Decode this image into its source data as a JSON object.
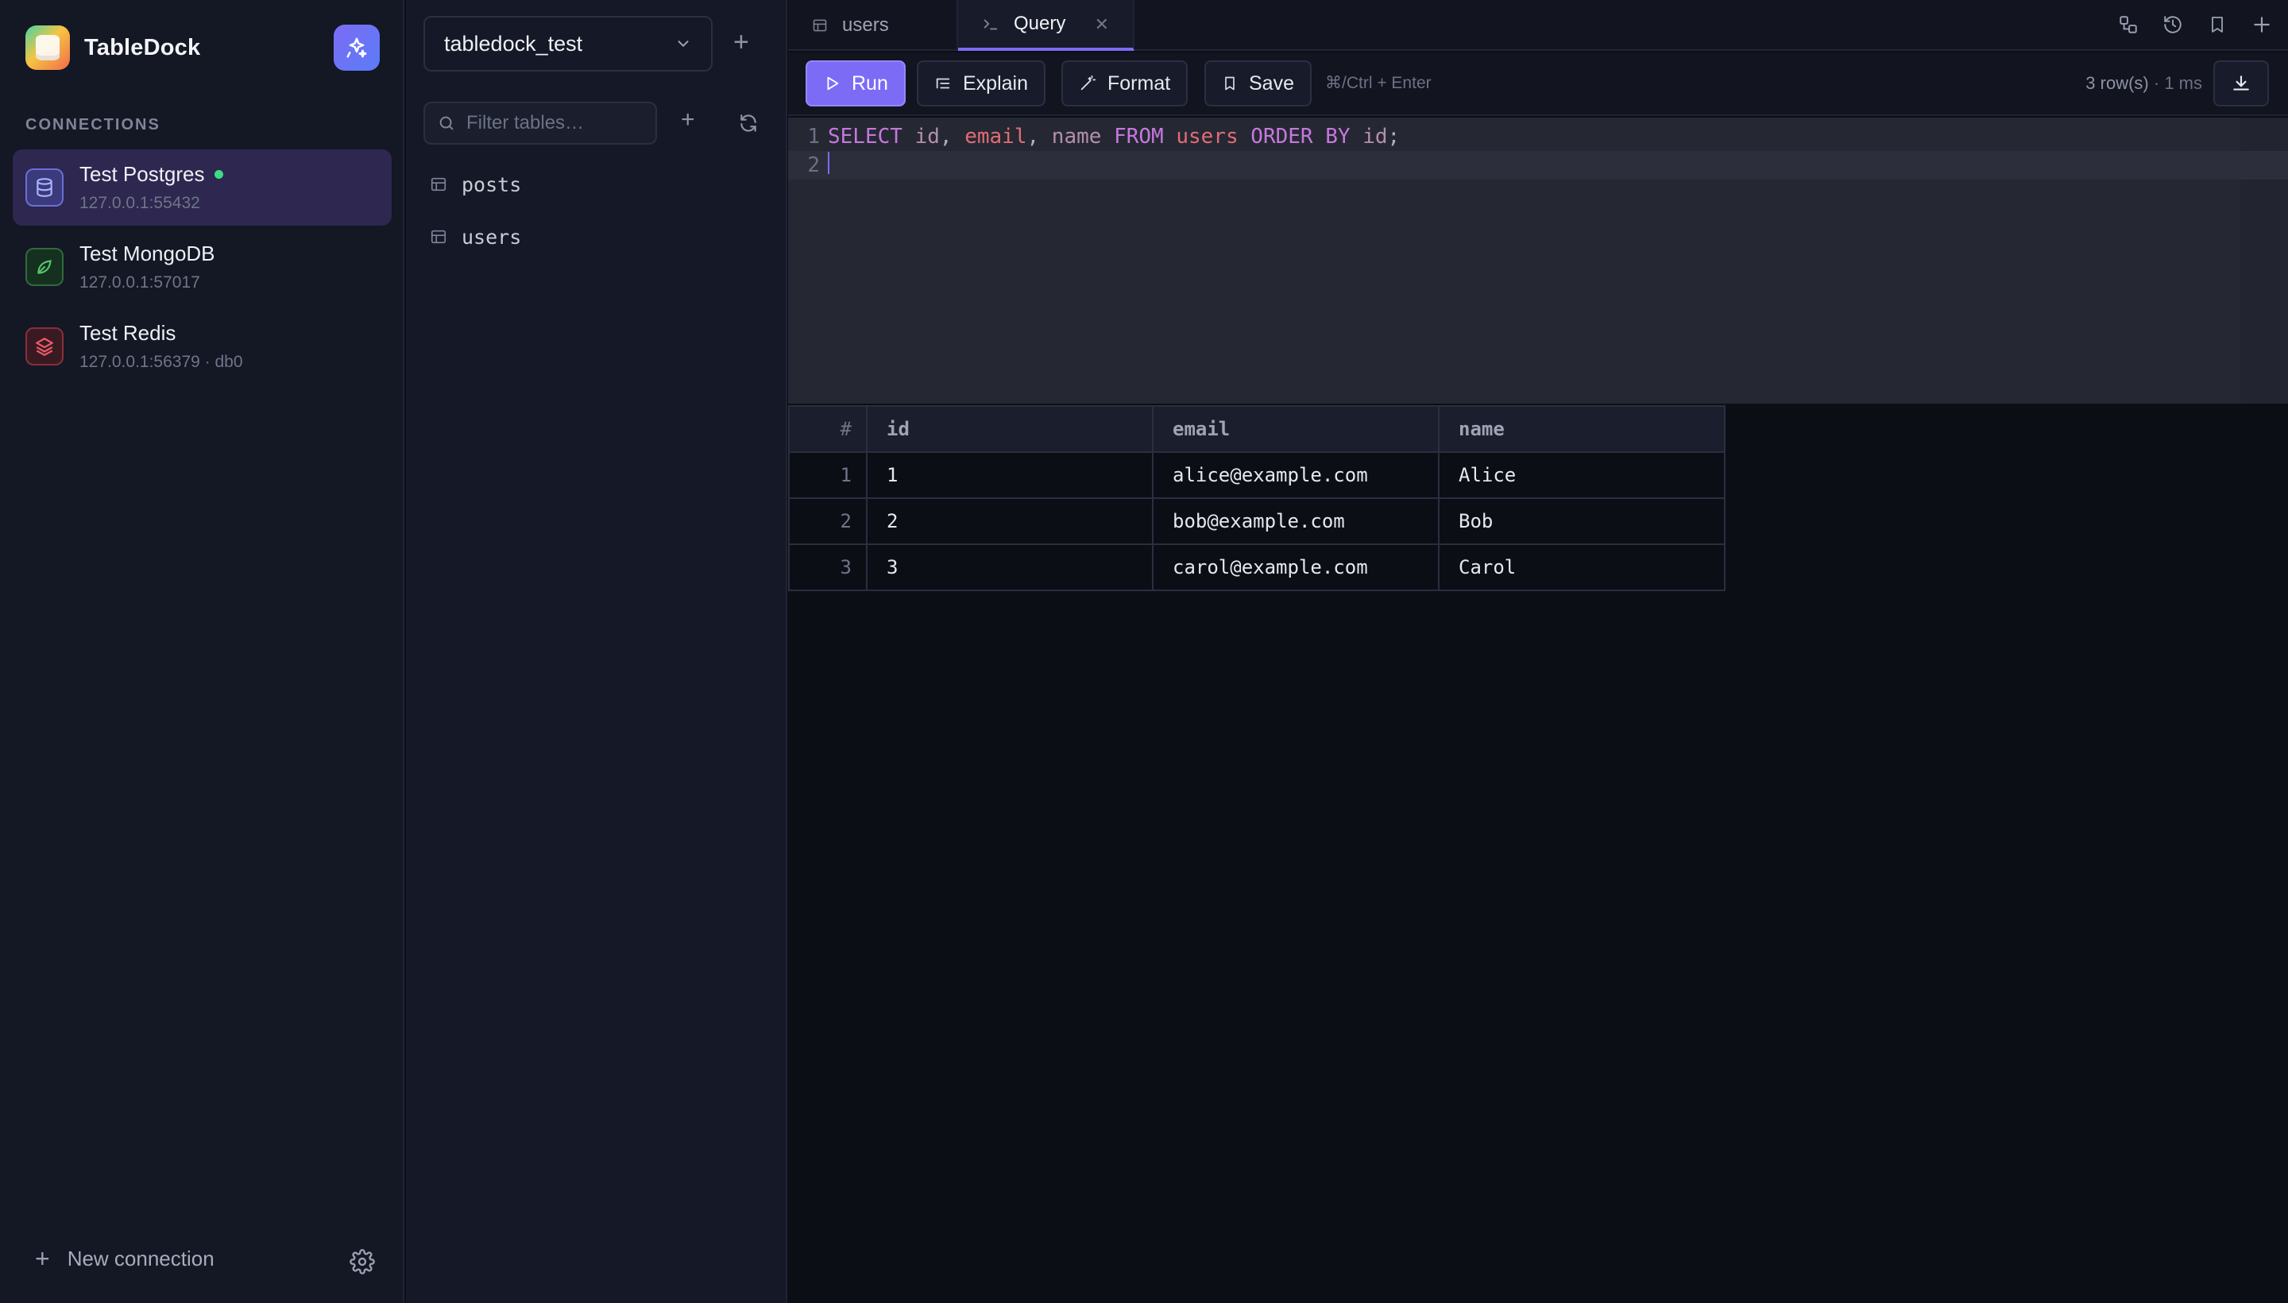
{
  "app": {
    "name": "TableDock"
  },
  "sidebar": {
    "section_label": "CONNECTIONS",
    "connections": [
      {
        "name": "Test Postgres",
        "host": "127.0.0.1:55432",
        "active": true,
        "status": "connected",
        "icon": "database-icon",
        "color": "#7c8cf5"
      },
      {
        "name": "Test MongoDB",
        "host": "127.0.0.1:57017",
        "active": false,
        "icon": "leaf-icon",
        "color": "#4caf50"
      },
      {
        "name": "Test Redis",
        "host": "127.0.0.1:56379 · db0",
        "active": false,
        "icon": "layers-icon",
        "color": "#e5484d"
      }
    ],
    "new_connection_label": "New connection"
  },
  "tables_panel": {
    "database": "tabledock_test",
    "filter_placeholder": "Filter tables…",
    "tables": [
      "posts",
      "users"
    ]
  },
  "tabs": [
    {
      "label": "users",
      "icon": "table-icon",
      "active": false
    },
    {
      "label": "Query",
      "icon": "terminal-icon",
      "active": true,
      "closable": true
    }
  ],
  "toolbar": {
    "run_label": "Run",
    "explain_label": "Explain",
    "format_label": "Format",
    "save_label": "Save",
    "shortcut_hint": "⌘/Ctrl + Enter",
    "row_count": "3 row(s)",
    "duration": "· 1 ms"
  },
  "editor": {
    "lines": [
      {
        "number": "1",
        "text": "SELECT id, email, name FROM users ORDER BY id;"
      },
      {
        "number": "2",
        "text": ""
      }
    ]
  },
  "results": {
    "row_number_header": "#",
    "columns": [
      "id",
      "email",
      "name"
    ],
    "rows": [
      {
        "n": "1",
        "cells": [
          "1",
          "alice@example.com",
          "Alice"
        ]
      },
      {
        "n": "2",
        "cells": [
          "2",
          "bob@example.com",
          "Bob"
        ]
      },
      {
        "n": "3",
        "cells": [
          "3",
          "carol@example.com",
          "Carol"
        ]
      }
    ]
  },
  "colors": {
    "accent": "#7c6cf5",
    "status_online": "#3ddc84"
  }
}
